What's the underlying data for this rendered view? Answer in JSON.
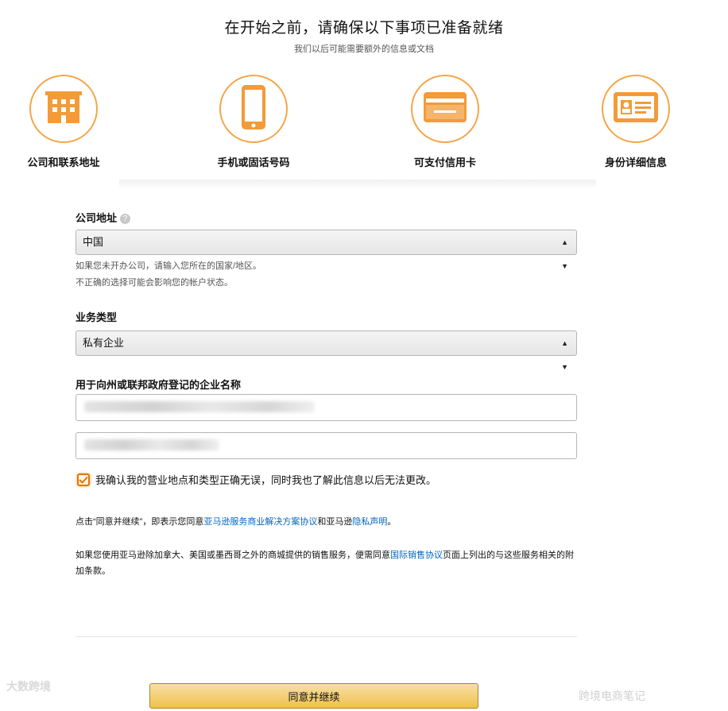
{
  "header": {
    "title": "在开始之前，请确保以下事项已准备就绪",
    "subtitle": "我们以后可能需要额外的信息或文档"
  },
  "steps": [
    {
      "label": "公司和联系地址",
      "icon": "building-icon"
    },
    {
      "label": "手机或固话号码",
      "icon": "phone-icon"
    },
    {
      "label": "可支付信用卡",
      "icon": "credit-card-icon"
    },
    {
      "label": "身份详细信息",
      "icon": "id-card-icon"
    }
  ],
  "form": {
    "company_address": {
      "label": "公司地址",
      "value": "中国",
      "note_line1": "如果您未开办公司，请输入您所在的国家/地区。",
      "note_line2": "不正确的选择可能会影响您的帐户状态。"
    },
    "business_type": {
      "label": "业务类型",
      "value": "私有企业"
    },
    "business_name": {
      "label": "用于向州或联邦政府登记的企业名称"
    },
    "confirm": {
      "checked": true,
      "text": "我确认我的营业地点和类型正确无误，同时我也了解此信息以后无法更改。"
    }
  },
  "agreement": {
    "prefix": "点击“同意并继续”，即表示您同意",
    "link1": "亚马逊服务商业解决方案协议",
    "middle": "和亚马逊",
    "link2": "隐私声明",
    "suffix": "。"
  },
  "intl": {
    "prefix": "如果您使用亚马逊除加拿大、美国或墨西哥之外的商城提供的销售服务，便需同意",
    "link": "国际销售协议",
    "suffix": "页面上列出的与这些服务相关的附加条款。"
  },
  "submit_button": "同意并继续",
  "watermark": {
    "left": "大数跨境",
    "right": "跨境电商笔记"
  },
  "colors": {
    "accent": "#f4a64b",
    "icon_fill": "#f29b38",
    "link": "#0066c0",
    "button": "#f0c14b"
  }
}
